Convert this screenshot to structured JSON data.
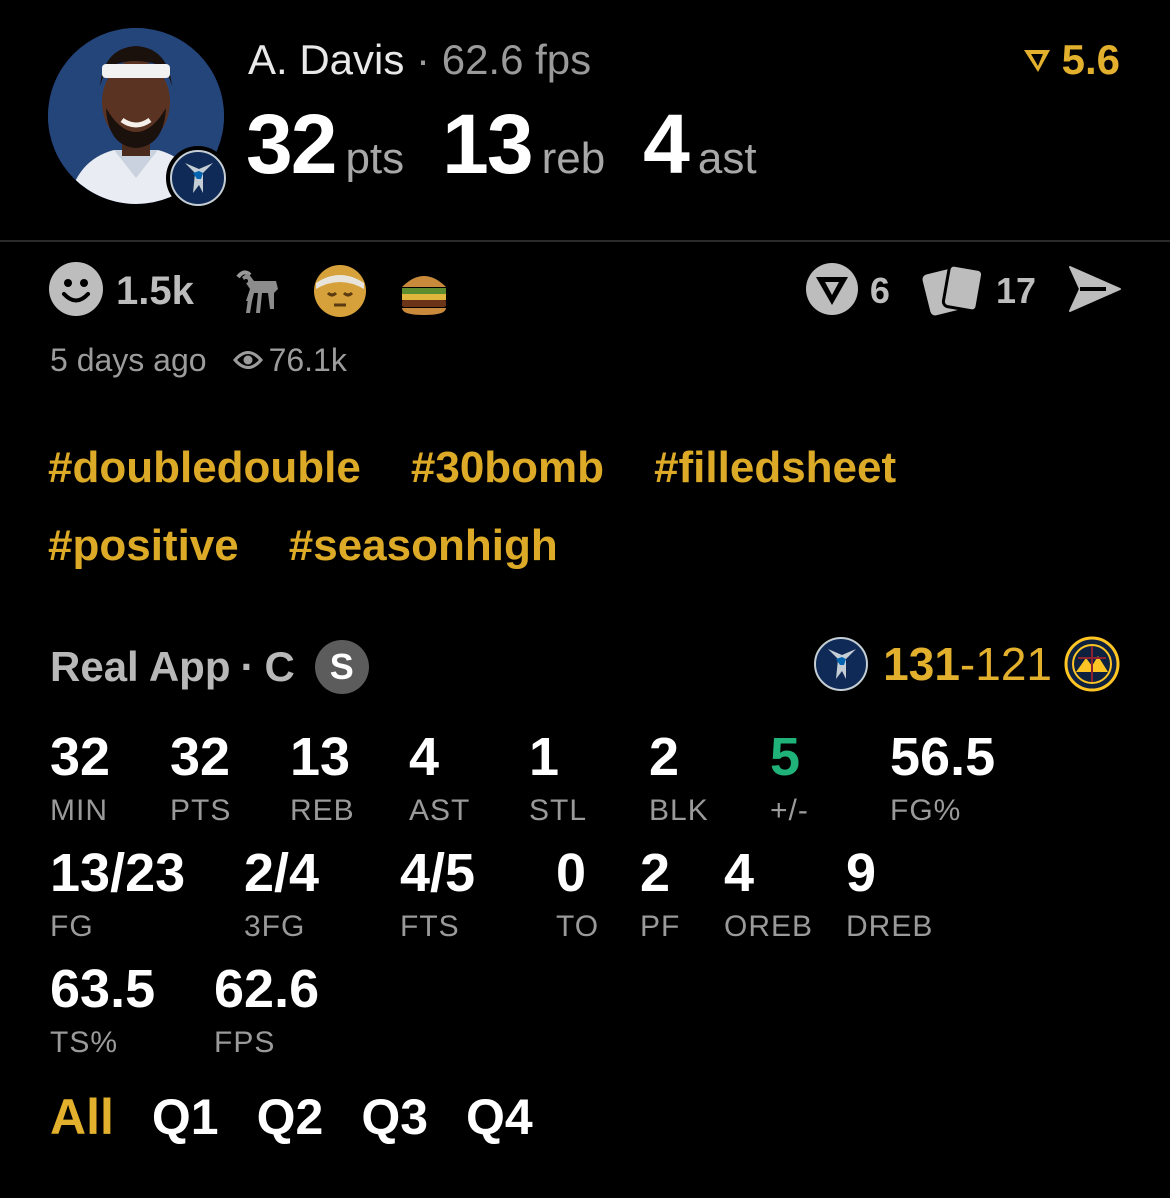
{
  "header": {
    "player_name": "A. Davis",
    "separator": "·",
    "fps_label": "62.6 fps",
    "stats": [
      {
        "value": "32",
        "unit": "pts"
      },
      {
        "value": "13",
        "unit": "reb"
      },
      {
        "value": "4",
        "unit": "ast"
      }
    ],
    "rating": "5.6"
  },
  "reactions": {
    "face_count": "1.5k",
    "emojis": [
      "goat-emoji",
      "bandaged-face-emoji",
      "burger-emoji"
    ],
    "comment_count": "6",
    "card_count": "17"
  },
  "meta": {
    "time_ago": "5 days ago",
    "views": "76.1k"
  },
  "hashtags": [
    "#doubledouble",
    "#30bomb",
    "#filledsheet",
    "#positive",
    "#seasonhigh"
  ],
  "source": {
    "name": "Real App",
    "separator": "·",
    "position": "C",
    "badge": "S"
  },
  "score": {
    "home": "131",
    "dash": "-",
    "away": "121"
  },
  "stats": {
    "row1": [
      {
        "value": "32",
        "label": "MIN"
      },
      {
        "value": "32",
        "label": "PTS"
      },
      {
        "value": "13",
        "label": "REB"
      },
      {
        "value": "4",
        "label": "AST"
      },
      {
        "value": "1",
        "label": "STL"
      },
      {
        "value": "2",
        "label": "BLK"
      },
      {
        "value": "5",
        "label": "+/-"
      },
      {
        "value": "56.5",
        "label": "FG%"
      }
    ],
    "row2": [
      {
        "value": "13/23",
        "label": "FG"
      },
      {
        "value": "2/4",
        "label": "3FG"
      },
      {
        "value": "4/5",
        "label": "FTS"
      },
      {
        "value": "0",
        "label": "TO"
      },
      {
        "value": "2",
        "label": "PF"
      },
      {
        "value": "4",
        "label": "OREB"
      },
      {
        "value": "9",
        "label": "DREB"
      }
    ],
    "row3": [
      {
        "value": "63.5",
        "label": "TS%"
      },
      {
        "value": "62.6",
        "label": "FPS"
      }
    ]
  },
  "quarters": [
    "All",
    "Q1",
    "Q2",
    "Q3",
    "Q4"
  ],
  "colors": {
    "accent": "#e3b02d",
    "hashtag": "#dcaa26",
    "positive": "#1fb37a",
    "background": "#000000"
  }
}
